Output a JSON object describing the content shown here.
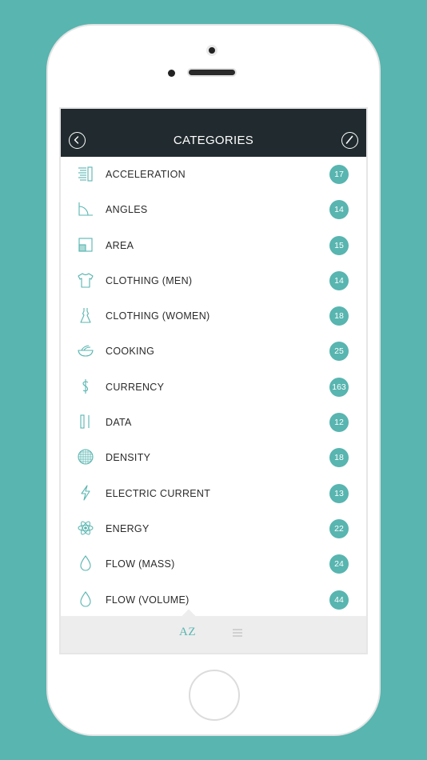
{
  "nav": {
    "title": "CATEGORIES",
    "back_icon": "chevron-left-icon",
    "edit_icon": "pencil-icon"
  },
  "colors": {
    "accent": "#58b5b0",
    "navbar": "#212b2f",
    "background": "#58b5b0",
    "text": "#2b2b2b"
  },
  "categories": [
    {
      "label": "ACCELERATION",
      "count": "17",
      "icon": "acceleration-icon"
    },
    {
      "label": "ANGLES",
      "count": "14",
      "icon": "angle-icon"
    },
    {
      "label": "AREA",
      "count": "15",
      "icon": "area-icon"
    },
    {
      "label": "CLOTHING (MEN)",
      "count": "14",
      "icon": "shirt-icon"
    },
    {
      "label": "CLOTHING (WOMEN)",
      "count": "18",
      "icon": "dress-icon"
    },
    {
      "label": "COOKING",
      "count": "25",
      "icon": "bowl-icon"
    },
    {
      "label": "CURRENCY",
      "count": "163",
      "icon": "dollar-icon"
    },
    {
      "label": "DATA",
      "count": "12",
      "icon": "data-icon"
    },
    {
      "label": "DENSITY",
      "count": "18",
      "icon": "density-icon"
    },
    {
      "label": "ELECTRIC CURRENT",
      "count": "13",
      "icon": "lightning-icon"
    },
    {
      "label": "ENERGY",
      "count": "22",
      "icon": "atom-icon"
    },
    {
      "label": "FLOW (MASS)",
      "count": "24",
      "icon": "drop-icon"
    },
    {
      "label": "FLOW (VOLUME)",
      "count": "44",
      "icon": "drop-icon"
    }
  ],
  "tabbar": {
    "az_label": "AZ",
    "list_icon": "list-icon"
  }
}
